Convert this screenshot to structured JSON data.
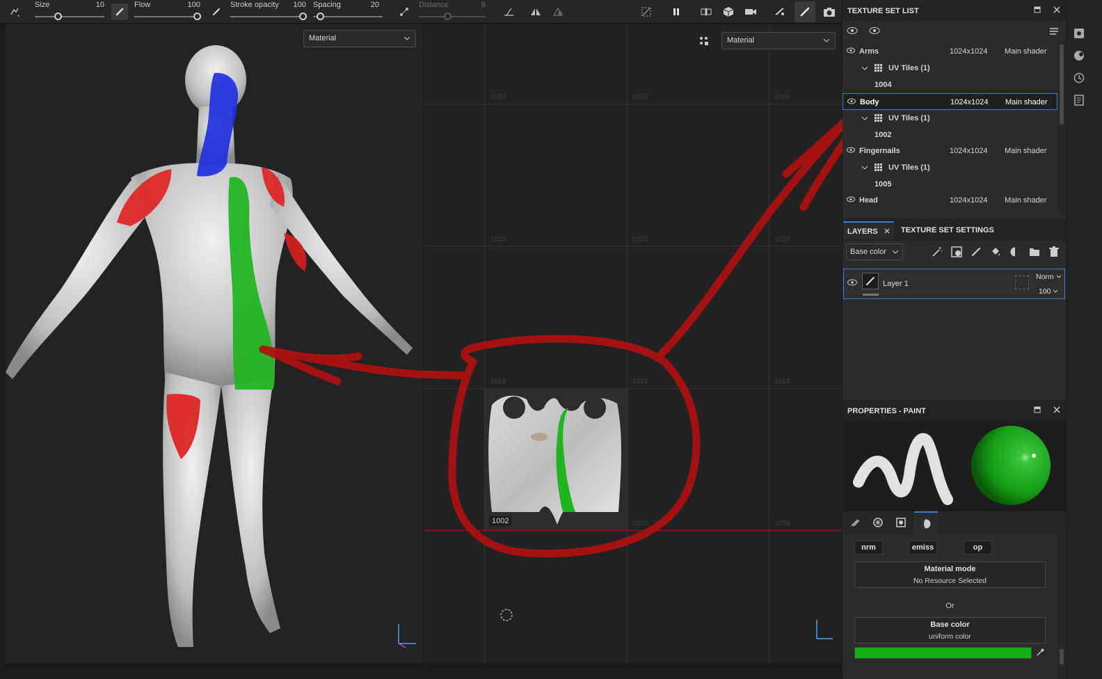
{
  "toolbar": {
    "size_label": "Size",
    "size_value": "10",
    "flow_label": "Flow",
    "flow_value": "100",
    "stroke_label": "Stroke opacity",
    "stroke_value": "100",
    "spacing_label": "Spacing",
    "spacing_value": "20",
    "distance_label": "Distance",
    "distance_value": "8"
  },
  "viewport3d": {
    "mode_dropdown": "Material"
  },
  "viewport2d": {
    "mode_dropdown": "Material",
    "tiles": [
      "1032",
      "1033",
      "1034",
      "1022",
      "1023",
      "1024",
      "1012",
      "1013",
      "1014",
      "1003",
      "1004"
    ],
    "active_tile": "1002"
  },
  "texture_set_list": {
    "title": "TEXTURE SET LIST",
    "sets": [
      {
        "name": "Arms",
        "resolution": "1024x1024",
        "shader": "Main shader",
        "uv_tiles": "UV Tiles (1)",
        "tile": "1004"
      },
      {
        "name": "Body",
        "resolution": "1024x1024",
        "shader": "Main shader",
        "uv_tiles": "UV Tiles (1)",
        "tile": "1002"
      },
      {
        "name": "Fingernails",
        "resolution": "1024x1024",
        "shader": "Main shader",
        "uv_tiles": "UV Tiles (1)",
        "tile": "1005"
      },
      {
        "name": "Head",
        "resolution": "1024x1024",
        "shader": "Main shader"
      }
    ]
  },
  "layers": {
    "tab_label": "LAYERS",
    "settings_tab_label": "TEXTURE SET SETTINGS",
    "channel_dropdown": "Base color",
    "layer": {
      "name": "Layer 1",
      "blend": "Norm",
      "opacity": "100"
    }
  },
  "properties": {
    "title": "PROPERTIES - PAINT",
    "chips": [
      "nrm",
      "emiss",
      "op"
    ],
    "material_mode_title": "Material mode",
    "material_mode_value": "No Resource Selected",
    "or_label": "Or",
    "base_color_title": "Base color",
    "base_color_value": "uniform color",
    "base_color_hex": "#0fb00f"
  },
  "colors": {
    "accent": "#3d7bd6",
    "annotation": "#c01010",
    "paint_green": "#22b522",
    "paint_red": "#e02020",
    "paint_blue": "#2030e0"
  }
}
